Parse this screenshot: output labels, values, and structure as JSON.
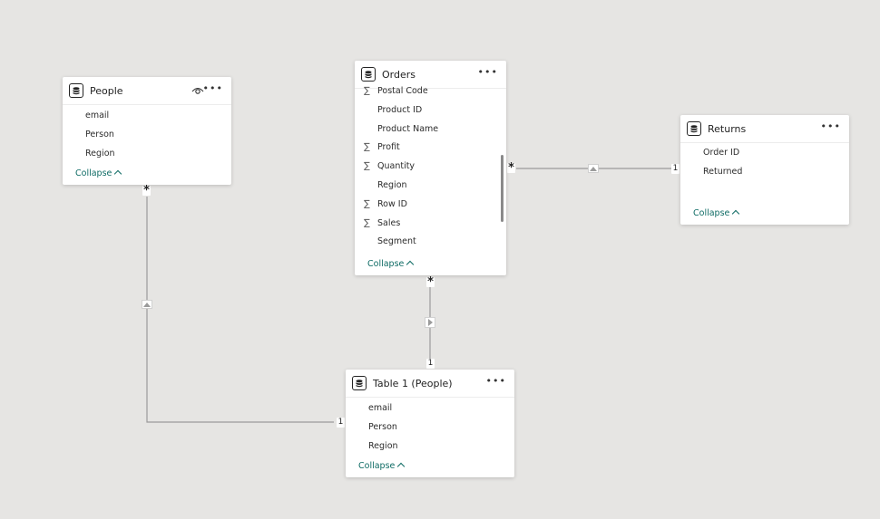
{
  "tables": {
    "people": {
      "title": "People",
      "fields": [
        "email",
        "Person",
        "Region"
      ],
      "collapse_label": "Collapse"
    },
    "orders": {
      "title": "Orders",
      "fields": [
        {
          "name": "Postal Code",
          "sigma": true
        },
        {
          "name": "Product ID",
          "sigma": false
        },
        {
          "name": "Product Name",
          "sigma": false
        },
        {
          "name": "Profit",
          "sigma": true
        },
        {
          "name": "Quantity",
          "sigma": true
        },
        {
          "name": "Region",
          "sigma": false
        },
        {
          "name": "Row ID",
          "sigma": true
        },
        {
          "name": "Sales",
          "sigma": true
        },
        {
          "name": "Segment",
          "sigma": false
        }
      ],
      "collapse_label": "Collapse"
    },
    "returns": {
      "title": "Returns",
      "fields": [
        "Order ID",
        "Returned"
      ],
      "collapse_label": "Collapse"
    },
    "table1": {
      "title": "Table 1 (People)",
      "fields": [
        "email",
        "Person",
        "Region"
      ],
      "collapse_label": "Collapse"
    }
  },
  "relationships": {
    "orders_returns": {
      "from": "*",
      "to": "1"
    },
    "orders_table1": {
      "from": "*",
      "to": "1"
    },
    "people_table1": {
      "from": "*",
      "to": "1"
    }
  },
  "icons": {
    "more": "more-options-icon",
    "table": "table-icon",
    "eye": "eye-icon",
    "sigma": "sum-icon"
  },
  "colors": {
    "background": "#e6e5e3",
    "collapse_link": "#0e6b64",
    "line": "#9b9b9b"
  }
}
